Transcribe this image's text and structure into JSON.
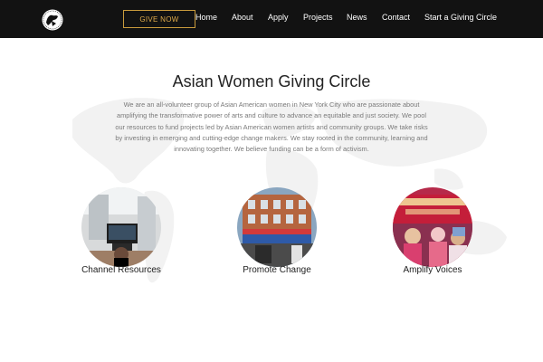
{
  "nav": {
    "give_now": "GIVE NOW",
    "links": [
      "Home",
      "About",
      "Apply",
      "Projects",
      "News",
      "Contact",
      "Start a Giving Circle"
    ]
  },
  "main": {
    "title": "Asian Women Giving Circle",
    "intro": "We are an all-volunteer group of Asian American women in New York City who are passionate about amplifying the transformative power of arts and culture to advance an equitable and just society. We pool our resources to fund projects led by Asian American women artists and community groups. We take risks by investing in emerging and cutting-edge change makers. We stay rooted in the community, learning and innovating together. We believe funding can be a form of activism.",
    "features": [
      {
        "label": "Channel Resources",
        "icon": "gallery-photo"
      },
      {
        "label": "Promote Change",
        "icon": "storefront-photo"
      },
      {
        "label": "Amplify Voices",
        "icon": "rally-photo"
      }
    ]
  },
  "colors": {
    "navbar_bg": "#121212",
    "accent": "#e0ab4a",
    "text_dark": "#222222",
    "text_muted": "#7a7a7a"
  }
}
